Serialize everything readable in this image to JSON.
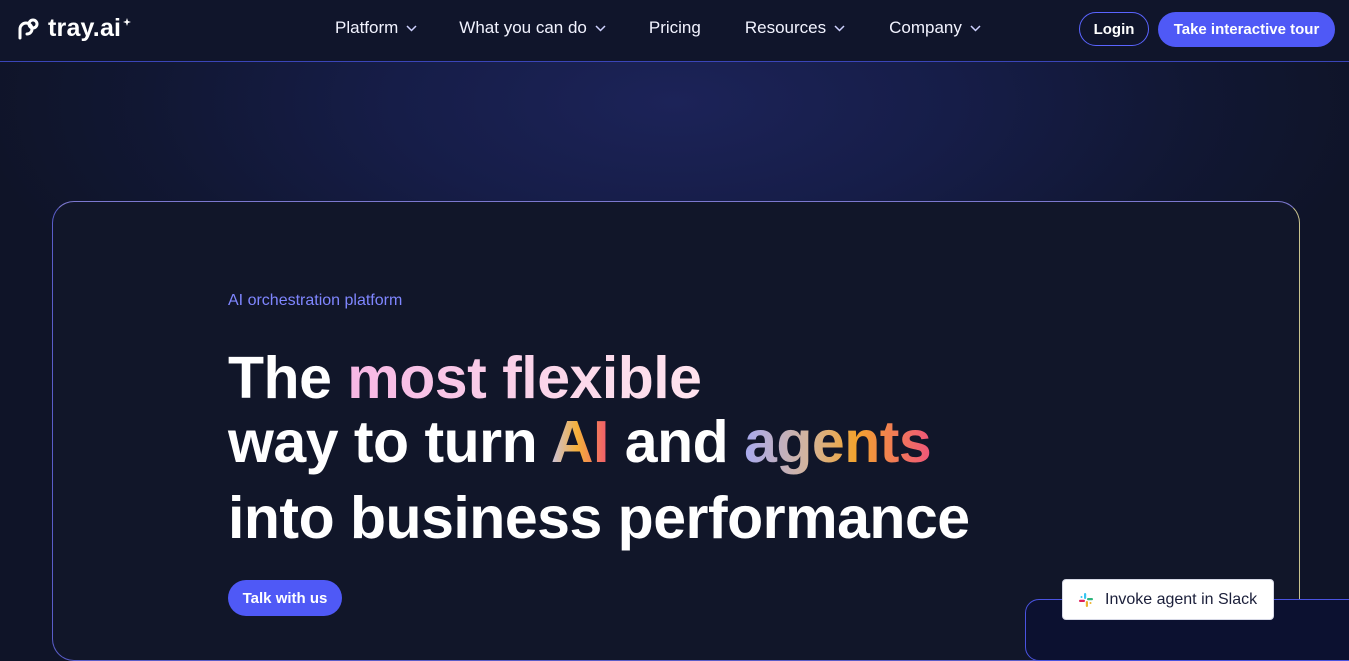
{
  "nav": {
    "logo_text": "tray.ai",
    "items": [
      {
        "label": "Platform",
        "has_dropdown": true
      },
      {
        "label": "What you can do",
        "has_dropdown": true
      },
      {
        "label": "Pricing",
        "has_dropdown": false
      },
      {
        "label": "Resources",
        "has_dropdown": true
      },
      {
        "label": "Company",
        "has_dropdown": true
      }
    ],
    "login_label": "Login",
    "tour_label": "Take interactive tour"
  },
  "hero": {
    "eyebrow": "AI orchestration platform",
    "line1_prefix": "The ",
    "line1_highlight": "most flexible",
    "line2_prefix": "way to turn ",
    "line2_ai": "AI",
    "line2_mid": " and ",
    "line2_agents": "agents",
    "line3": "into business performance",
    "cta_label": "Talk with us"
  },
  "slack_chip": {
    "label": "Invoke agent in Slack",
    "icon": "slack-icon"
  },
  "colors": {
    "accent": "#4f59f6",
    "eyebrow": "#7f86ff",
    "background": "#0f1428"
  }
}
